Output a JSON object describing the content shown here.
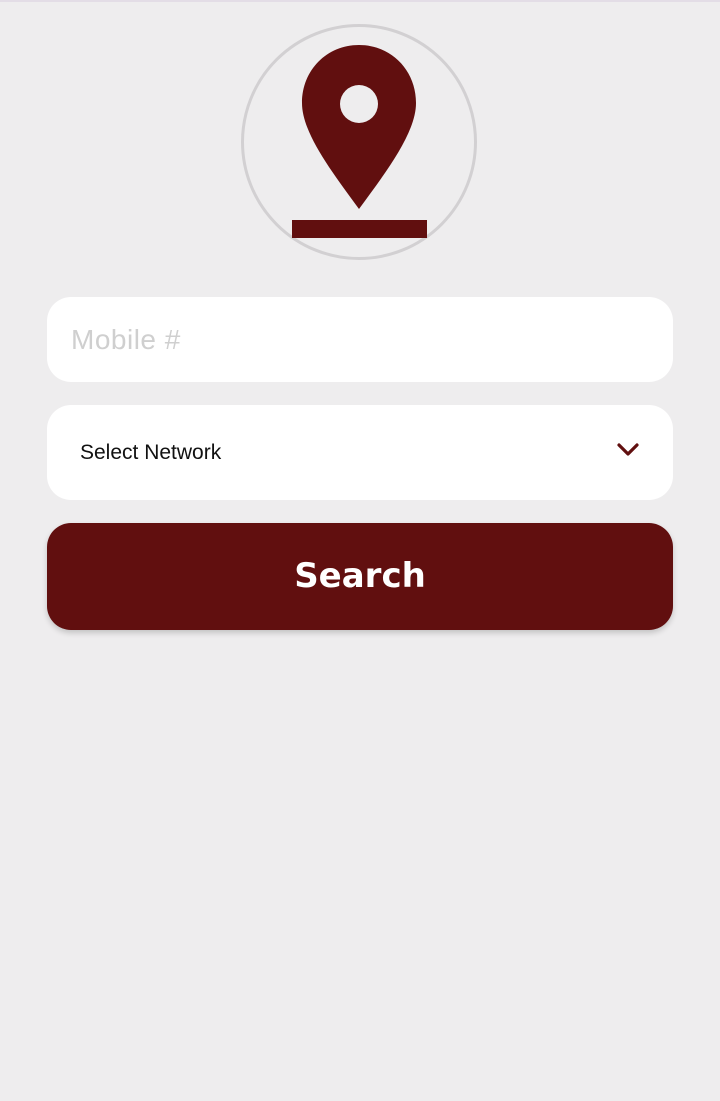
{
  "theme": {
    "brand_color": "#610f0f",
    "background": "#eeedee",
    "field_background": "#ffffff"
  },
  "logo": {
    "icon": "location-pin-icon"
  },
  "form": {
    "mobile_placeholder": "Mobile #",
    "mobile_value": "",
    "network_label": "Select Network",
    "network_icon": "chevron-down-icon",
    "search_label": "Search"
  }
}
